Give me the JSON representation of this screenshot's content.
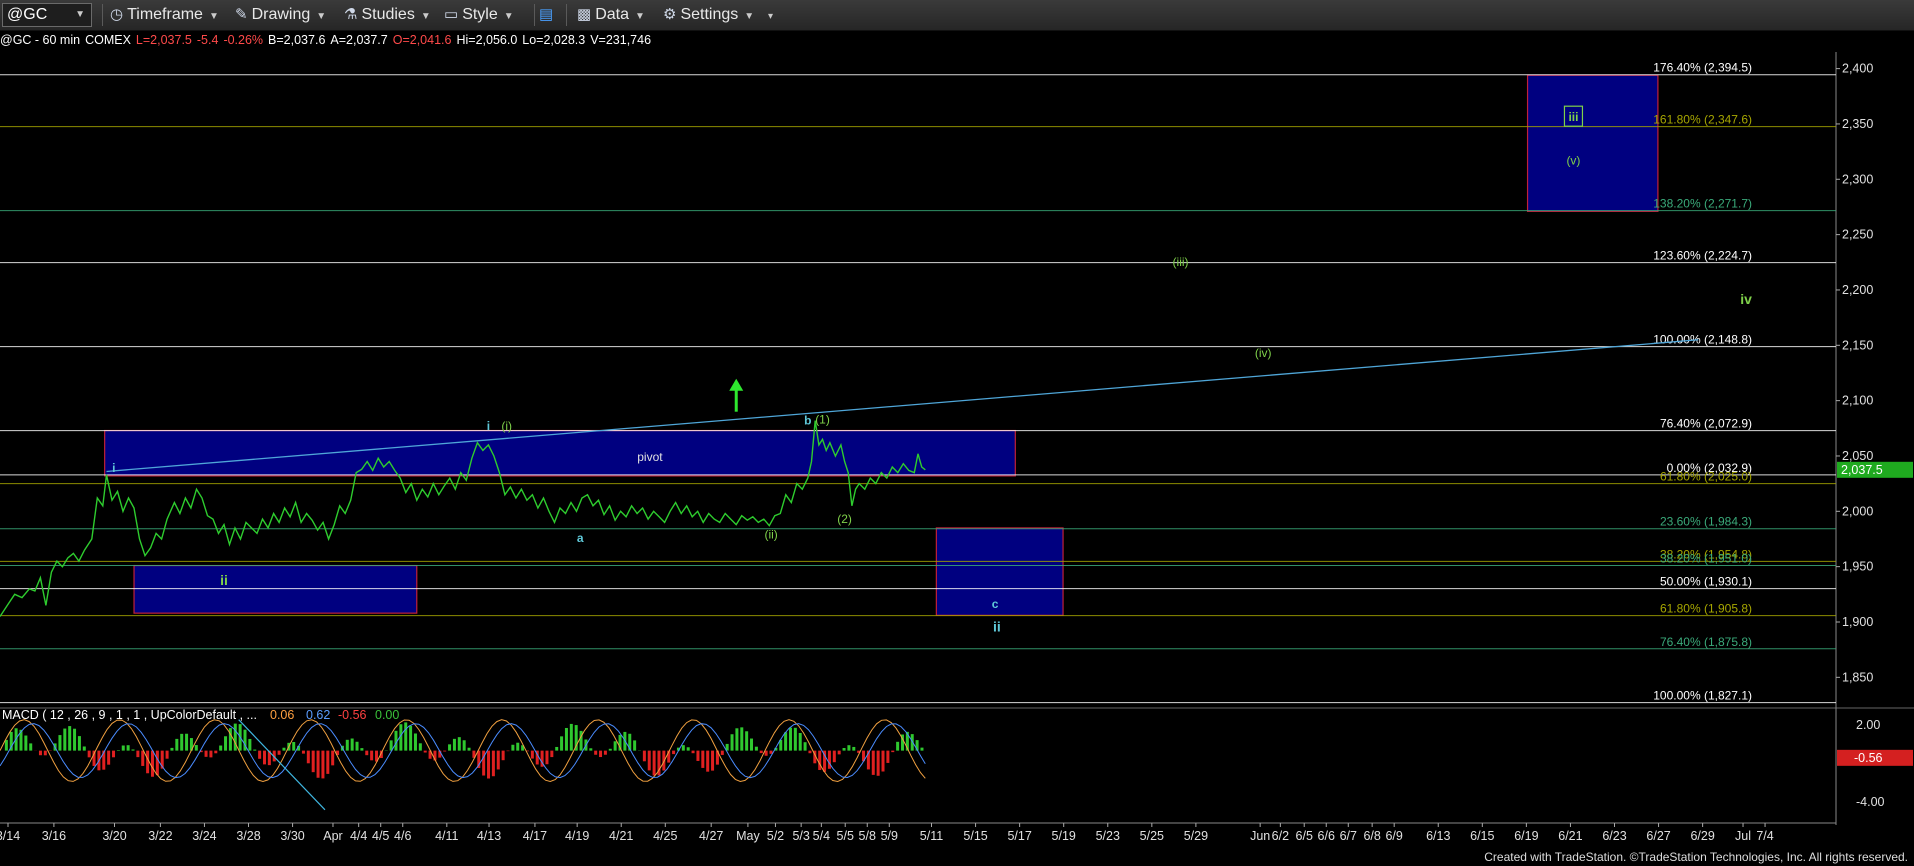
{
  "toolbar": {
    "symbol": "@GC",
    "timeframe": "Timeframe",
    "drawing": "Drawing",
    "studies": "Studies",
    "style": "Style",
    "data": "Data",
    "settings": "Settings"
  },
  "info": {
    "name": "@GC - 60 min",
    "exchange": "COMEX",
    "last": "L=2,037.5",
    "chg": "-5.4",
    "pct": "-0.26%",
    "bid": "B=2,037.6",
    "ask": "A=2,037.7",
    "open": "O=2,041.6",
    "high": "Hi=2,056.0",
    "low": "Lo=2,028.3",
    "vol": "V=231,746"
  },
  "colors": {
    "up": "#ff5050",
    "price": "#2ecc2e",
    "box": "#000080",
    "box_border": "#c0203a",
    "wave_green": "#7fd14a",
    "wave_cyan": "#5fc8d8",
    "trend": "#4fa6d8"
  },
  "footer": "Created with TradeStation. ©TradeStation Technologies, Inc. All rights reserved.",
  "chart_data": {
    "type": "line",
    "title": "@GC - 60 min",
    "ylim": [
      1825,
      2415
    ],
    "y_ticks": [
      "2,400",
      "2,350",
      "2,300",
      "2,250",
      "2,200",
      "2,150",
      "2,100",
      "2,050",
      "2,000",
      "1,950",
      "1,900",
      "1,850"
    ],
    "y_tick_values": [
      2400,
      2350,
      2300,
      2250,
      2200,
      2150,
      2100,
      2050,
      2000,
      1950,
      1900,
      1850
    ],
    "x_ticks": [
      "3/14",
      "3/16",
      "3/20",
      "3/22",
      "3/24",
      "3/28",
      "3/30",
      "Apr",
      "4/4",
      "4/5",
      "4/6",
      "4/11",
      "4/13",
      "4/17",
      "4/19",
      "4/21",
      "4/25",
      "4/27",
      "May",
      "5/2",
      "5/3",
      "5/4",
      "5/5",
      "5/8",
      "5/9",
      "5/11",
      "5/15",
      "5/17",
      "5/19",
      "5/23",
      "5/25",
      "5/29",
      "Jun",
      "6/2",
      "6/5",
      "6/6",
      "6/7",
      "6/8",
      "6/9",
      "6/13",
      "6/15",
      "6/19",
      "6/21",
      "6/23",
      "6/27",
      "6/29",
      "Jul",
      "7/4"
    ],
    "x_tick_positions": [
      0.0,
      0.025,
      0.058,
      0.083,
      0.107,
      0.131,
      0.155,
      0.177,
      0.191,
      0.203,
      0.215,
      0.239,
      0.262,
      0.287,
      0.31,
      0.334,
      0.358,
      0.383,
      0.403,
      0.418,
      0.432,
      0.443,
      0.456,
      0.468,
      0.48,
      0.503,
      0.527,
      0.551,
      0.575,
      0.599,
      0.623,
      0.647,
      0.682,
      0.693,
      0.706,
      0.718,
      0.73,
      0.743,
      0.755,
      0.779,
      0.803,
      0.827,
      0.851,
      0.875,
      0.899,
      0.923,
      0.945,
      0.957
    ],
    "last_price": "2,037.5",
    "last_value": 2037.5,
    "price_series": [
      [
        0.0,
        1905
      ],
      [
        0.004,
        1915
      ],
      [
        0.008,
        1925
      ],
      [
        0.012,
        1922
      ],
      [
        0.016,
        1930
      ],
      [
        0.019,
        1928
      ],
      [
        0.022,
        1940
      ],
      [
        0.025,
        1915
      ],
      [
        0.028,
        1945
      ],
      [
        0.031,
        1955
      ],
      [
        0.034,
        1950
      ],
      [
        0.037,
        1958
      ],
      [
        0.04,
        1962
      ],
      [
        0.043,
        1955
      ],
      [
        0.046,
        1965
      ],
      [
        0.05,
        1975
      ],
      [
        0.053,
        2012
      ],
      [
        0.056,
        2005
      ],
      [
        0.058,
        2033
      ],
      [
        0.061,
        2010
      ],
      [
        0.064,
        2018
      ],
      [
        0.067,
        2000
      ],
      [
        0.07,
        2012
      ],
      [
        0.073,
        2003
      ],
      [
        0.076,
        1975
      ],
      [
        0.079,
        1960
      ],
      [
        0.082,
        1967
      ],
      [
        0.085,
        1980
      ],
      [
        0.088,
        1975
      ],
      [
        0.091,
        1993
      ],
      [
        0.095,
        2008
      ],
      [
        0.098,
        1998
      ],
      [
        0.101,
        2012
      ],
      [
        0.104,
        2003
      ],
      [
        0.107,
        2020
      ],
      [
        0.11,
        2012
      ],
      [
        0.113,
        1996
      ],
      [
        0.116,
        1993
      ],
      [
        0.119,
        1980
      ],
      [
        0.122,
        1988
      ],
      [
        0.125,
        1970
      ],
      [
        0.128,
        1985
      ],
      [
        0.131,
        1975
      ],
      [
        0.134,
        1990
      ],
      [
        0.137,
        1985
      ],
      [
        0.14,
        1980
      ],
      [
        0.143,
        1993
      ],
      [
        0.146,
        1985
      ],
      [
        0.149,
        1998
      ],
      [
        0.152,
        1990
      ],
      [
        0.155,
        2003
      ],
      [
        0.158,
        1995
      ],
      [
        0.161,
        2008
      ],
      [
        0.164,
        1990
      ],
      [
        0.167,
        1998
      ],
      [
        0.17,
        1992
      ],
      [
        0.173,
        1983
      ],
      [
        0.176,
        1990
      ],
      [
        0.179,
        1975
      ],
      [
        0.182,
        1988
      ],
      [
        0.185,
        2005
      ],
      [
        0.188,
        1998
      ],
      [
        0.191,
        2010
      ],
      [
        0.194,
        2035
      ],
      [
        0.197,
        2038
      ],
      [
        0.2,
        2045
      ],
      [
        0.203,
        2037
      ],
      [
        0.206,
        2048
      ],
      [
        0.209,
        2040
      ],
      [
        0.212,
        2045
      ],
      [
        0.215,
        2037
      ],
      [
        0.218,
        2030
      ],
      [
        0.221,
        2017
      ],
      [
        0.224,
        2025
      ],
      [
        0.227,
        2010
      ],
      [
        0.23,
        2020
      ],
      [
        0.233,
        2013
      ],
      [
        0.236,
        2025
      ],
      [
        0.239,
        2015
      ],
      [
        0.242,
        2023
      ],
      [
        0.245,
        2030
      ],
      [
        0.248,
        2020
      ],
      [
        0.251,
        2035
      ],
      [
        0.254,
        2028
      ],
      [
        0.257,
        2048
      ],
      [
        0.26,
        2062
      ],
      [
        0.263,
        2055
      ],
      [
        0.266,
        2060
      ],
      [
        0.269,
        2050
      ],
      [
        0.272,
        2035
      ],
      [
        0.275,
        2015
      ],
      [
        0.278,
        2022
      ],
      [
        0.281,
        2012
      ],
      [
        0.284,
        2020
      ],
      [
        0.287,
        2010
      ],
      [
        0.29,
        2015
      ],
      [
        0.293,
        2003
      ],
      [
        0.296,
        2012
      ],
      [
        0.299,
        2000
      ],
      [
        0.302,
        1990
      ],
      [
        0.305,
        2003
      ],
      [
        0.308,
        1998
      ],
      [
        0.311,
        2008
      ],
      [
        0.314,
        2000
      ],
      [
        0.317,
        2012
      ],
      [
        0.32,
        2015
      ],
      [
        0.323,
        2005
      ],
      [
        0.326,
        2010
      ],
      [
        0.329,
        1997
      ],
      [
        0.332,
        2005
      ],
      [
        0.335,
        1992
      ],
      [
        0.338,
        2000
      ],
      [
        0.341,
        1995
      ],
      [
        0.344,
        2005
      ],
      [
        0.347,
        1998
      ],
      [
        0.35,
        2003
      ],
      [
        0.353,
        1993
      ],
      [
        0.356,
        2000
      ],
      [
        0.359,
        1995
      ],
      [
        0.362,
        1990
      ],
      [
        0.365,
        2000
      ],
      [
        0.368,
        2008
      ],
      [
        0.371,
        1998
      ],
      [
        0.374,
        2005
      ],
      [
        0.377,
        1995
      ],
      [
        0.38,
        2000
      ],
      [
        0.383,
        1990
      ],
      [
        0.386,
        1998
      ],
      [
        0.389,
        1993
      ],
      [
        0.392,
        1990
      ],
      [
        0.395,
        1998
      ],
      [
        0.398,
        1993
      ],
      [
        0.401,
        1988
      ],
      [
        0.404,
        1996
      ],
      [
        0.407,
        1992
      ],
      [
        0.41,
        1995
      ],
      [
        0.413,
        1990
      ],
      [
        0.416,
        1993
      ],
      [
        0.419,
        1987
      ],
      [
        0.422,
        1996
      ],
      [
        0.425,
        1998
      ],
      [
        0.428,
        2015
      ],
      [
        0.431,
        2008
      ],
      [
        0.434,
        2025
      ],
      [
        0.437,
        2020
      ],
      [
        0.44,
        2030
      ],
      [
        0.442,
        2045
      ],
      [
        0.444,
        2082
      ],
      [
        0.446,
        2060
      ],
      [
        0.448,
        2065
      ],
      [
        0.45,
        2055
      ],
      [
        0.452,
        2062
      ],
      [
        0.455,
        2050
      ],
      [
        0.458,
        2060
      ],
      [
        0.46,
        2045
      ],
      [
        0.462,
        2035
      ],
      [
        0.464,
        2005
      ],
      [
        0.466,
        2020
      ],
      [
        0.468,
        2025
      ],
      [
        0.471,
        2020
      ],
      [
        0.474,
        2030
      ],
      [
        0.477,
        2025
      ],
      [
        0.48,
        2035
      ],
      [
        0.483,
        2030
      ],
      [
        0.486,
        2040
      ],
      [
        0.489,
        2035
      ],
      [
        0.492,
        2043
      ],
      [
        0.495,
        2037
      ],
      [
        0.498,
        2035
      ],
      [
        0.5,
        2052
      ],
      [
        0.502,
        2040
      ],
      [
        0.504,
        2037.5
      ]
    ],
    "pivot_box": {
      "x": [
        0.057,
        0.553
      ],
      "y": [
        2032,
        2073
      ],
      "label": "pivot"
    },
    "target_boxes": [
      {
        "x": [
          0.073,
          0.227
        ],
        "y": [
          1908,
          1951
        ]
      },
      {
        "x": [
          0.51,
          0.579
        ],
        "y": [
          1906,
          1985
        ]
      },
      {
        "x": [
          0.832,
          0.903
        ],
        "y": [
          2271,
          2394
        ]
      }
    ],
    "fib_levels": [
      {
        "label": "176.40% (2,394.5)",
        "value": 2394.5,
        "color": "#ffffff"
      },
      {
        "label": "161.80% (2,347.6)",
        "value": 2347.6,
        "color": "#a6a600"
      },
      {
        "label": "138.20% (2,271.7)",
        "value": 2271.7,
        "color": "#3aaa7a"
      },
      {
        "label": "123.60% (2,224.7)",
        "value": 2224.7,
        "color": "#ffffff"
      },
      {
        "label": "100.00% (2,148.8)",
        "value": 2148.8,
        "color": "#ffffff"
      },
      {
        "label": "76.40% (2,072.9)",
        "value": 2072.9,
        "color": "#ffffff"
      },
      {
        "label": "0.00% (2,032.9)",
        "value": 2032.9,
        "color": "#ffffff"
      },
      {
        "label": "61.80% (2,025.0)",
        "value": 2025.0,
        "color": "#a6a600"
      },
      {
        "label": "23.60% (1,984.3)",
        "value": 1984.3,
        "color": "#3aaa7a"
      },
      {
        "label": "38.20% (1,954.8)",
        "value": 1954.8,
        "color": "#a6a600"
      },
      {
        "label": "38.20% (1,951.0)",
        "value": 1951.0,
        "color": "#3aaa7a"
      },
      {
        "label": "50.00% (1,930.1)",
        "value": 1930.1,
        "color": "#ffffff"
      },
      {
        "label": "61.80% (1,905.8)",
        "value": 1905.8,
        "color": "#a6a600"
      },
      {
        "label": "76.40% (1,875.8)",
        "value": 1875.8,
        "color": "#3aaa7a"
      },
      {
        "label": "100.00% (1,827.1)",
        "value": 1827.1,
        "color": "#ffffff"
      }
    ],
    "trendline": {
      "x": [
        0.058,
        0.925
      ],
      "y": [
        2036,
        2155
      ]
    },
    "wave_labels": [
      {
        "text": "i",
        "x": 0.062,
        "y": 2040,
        "color": "#5fc8d8"
      },
      {
        "text": "ii",
        "x": 0.122,
        "y": 1938,
        "color": "#7fd14a"
      },
      {
        "text": "i",
        "x": 0.266,
        "y": 2078,
        "color": "#5fc8d8"
      },
      {
        "text": "(i)",
        "x": 0.276,
        "y": 2078,
        "color": "#7fd14a"
      },
      {
        "text": "pivot",
        "x": 0.354,
        "y": 2050,
        "color": "#e0e0e0"
      },
      {
        "text": "a",
        "x": 0.316,
        "y": 1977,
        "color": "#5fc8d8"
      },
      {
        "text": "(ii)",
        "x": 0.42,
        "y": 1980,
        "color": "#7fd14a"
      },
      {
        "text": "b",
        "x": 0.44,
        "y": 2083,
        "color": "#5fc8d8"
      },
      {
        "text": "(1)",
        "x": 0.448,
        "y": 2084,
        "color": "#7fd14a"
      },
      {
        "text": "(2)",
        "x": 0.46,
        "y": 1994,
        "color": "#7fd14a"
      },
      {
        "text": "c",
        "x": 0.542,
        "y": 1917,
        "color": "#5fc8d8"
      },
      {
        "text": "ii",
        "x": 0.543,
        "y": 1896,
        "color": "#5fc8d8"
      },
      {
        "text": "(iii)",
        "x": 0.643,
        "y": 2226,
        "color": "#7fd14a"
      },
      {
        "text": "(iv)",
        "x": 0.688,
        "y": 2144,
        "color": "#7fd14a"
      },
      {
        "text": "iv",
        "x": 0.951,
        "y": 2192,
        "color": "#7fd14a"
      },
      {
        "text": "iii",
        "x": 0.857,
        "y": 2357,
        "color": "#7fd14a"
      },
      {
        "text": "(v)",
        "x": 0.857,
        "y": 2318,
        "color": "#7fd14a"
      }
    ],
    "up_arrow": {
      "x": 0.401,
      "y": [
        2090,
        2118
      ]
    },
    "macd": {
      "label": "MACD ( 12 , 26 , 9 , 1 , 1 , UpColorDefault , ...",
      "values": [
        "0.06",
        "0.62",
        "-0.56",
        "0.00"
      ],
      "value_colors": [
        "#ffa040",
        "#5a9cff",
        "#ff4040",
        "#3ac03a"
      ],
      "ylim": [
        -5,
        3
      ],
      "y_ticks": [
        "2.00",
        "-4.00"
      ],
      "y_tick_values": [
        2.0,
        -4.0
      ],
      "last_value": "-0.56",
      "last_y": -0.56
    }
  }
}
